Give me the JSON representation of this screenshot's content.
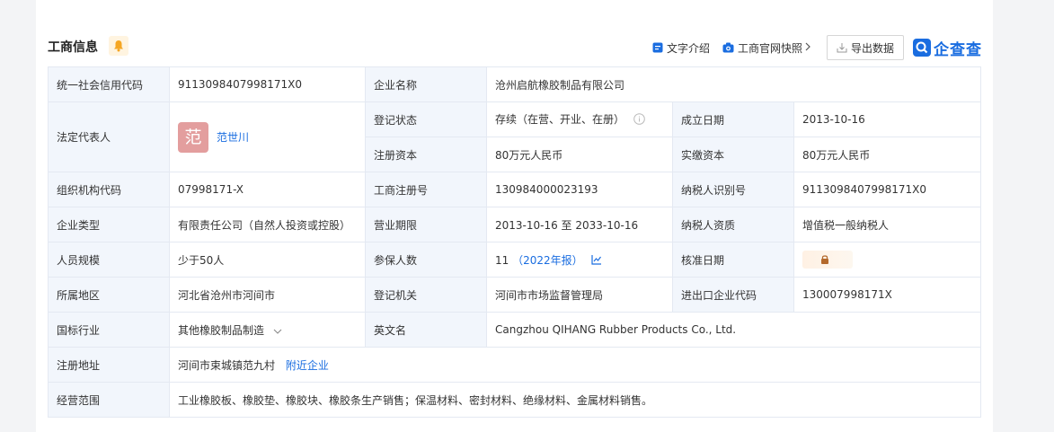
{
  "header": {
    "title": "工商信息",
    "text_intro": "文字介绍",
    "snapshot": "工商官网快照",
    "export": "导出数据",
    "logo": "企查查"
  },
  "rows": {
    "uscc_label": "统一社会信用代码",
    "uscc_value": "9113098407998171X0",
    "company_name_label": "企业名称",
    "company_name_value": "沧州启航橡胶制品有限公司",
    "legal_rep_label": "法定代表人",
    "legal_rep_avatar": "范",
    "legal_rep_name": "范世川",
    "reg_status_label": "登记状态",
    "reg_status_value": "存续（在营、开业、在册）",
    "est_date_label": "成立日期",
    "est_date_value": "2013-10-16",
    "reg_capital_label": "注册资本",
    "reg_capital_value": "80万元人民币",
    "paid_capital_label": "实缴资本",
    "paid_capital_value": "80万元人民币",
    "org_code_label": "组织机构代码",
    "org_code_value": "07998171-X",
    "biz_reg_no_label": "工商注册号",
    "biz_reg_no_value": "130984000023193",
    "taxpayer_id_label": "纳税人识别号",
    "taxpayer_id_value": "9113098407998171X0",
    "ent_type_label": "企业类型",
    "ent_type_value": "有限责任公司（自然人投资或控股）",
    "biz_term_label": "营业期限",
    "biz_term_value": "2013-10-16 至 2033-10-16",
    "taxpayer_qual_label": "纳税人资质",
    "taxpayer_qual_value": "增值税一般纳税人",
    "staff_size_label": "人员规模",
    "staff_size_value": "少于50人",
    "insured_label": "参保人数",
    "insured_value": "11",
    "insured_year": "（2022年报）",
    "approval_date_label": "核准日期",
    "region_label": "所属地区",
    "region_value": "河北省沧州市河间市",
    "reg_authority_label": "登记机关",
    "reg_authority_value": "河间市市场监督管理局",
    "import_export_label": "进出口企业代码",
    "import_export_value": "130007998171X",
    "industry_label": "国标行业",
    "industry_value": "其他橡胶制品制造",
    "english_name_label": "英文名",
    "english_name_value": "Cangzhou QIHANG Rubber Products Co., Ltd.",
    "reg_address_label": "注册地址",
    "reg_address_value": "河间市束城镇范九村",
    "nearby_label": "附近企业",
    "scope_label": "经营范围",
    "scope_value": "工业橡胶板、橡胶垫、橡胶块、橡胶条生产销售；保温材料、密封材料、绝缘材料、金属材料销售。"
  },
  "colors": {
    "accent": "#1a6de0",
    "label_bg": "#f2f6fc",
    "border": "#e4e9f2",
    "avatar_bg": "#e39e9e",
    "bell": "#f5a623"
  },
  "icons": [
    "bell-icon",
    "document-icon",
    "camera-icon",
    "chevron-right-icon",
    "export-icon",
    "info-circle-icon",
    "chart-icon",
    "chevron-down-icon",
    "lock-icon"
  ]
}
